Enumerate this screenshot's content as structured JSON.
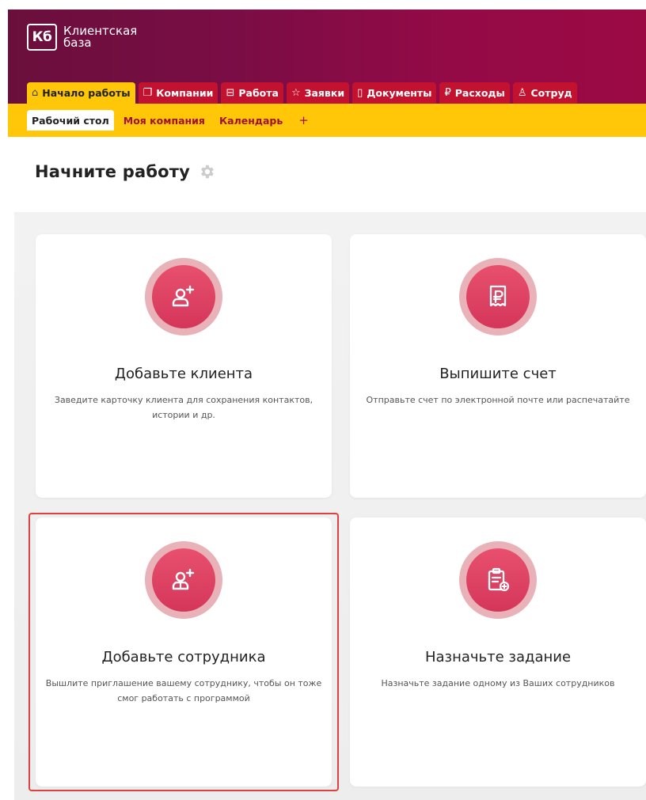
{
  "app": {
    "logo_mark": "Кб",
    "name_line1": "Клиентская",
    "name_line2": "база"
  },
  "tabs": [
    {
      "label": "Начало работы",
      "icon": "home-icon",
      "glyph": "⌂",
      "active": true
    },
    {
      "label": "Компании",
      "icon": "copy-icon",
      "glyph": "❐",
      "active": false
    },
    {
      "label": "Работа",
      "icon": "briefcase-icon",
      "glyph": "⊟",
      "active": false
    },
    {
      "label": "Заявки",
      "icon": "star-icon",
      "glyph": "☆",
      "active": false
    },
    {
      "label": "Документы",
      "icon": "document-icon",
      "glyph": "▯",
      "active": false
    },
    {
      "label": "Расходы",
      "icon": "ruble-icon",
      "glyph": "₽",
      "active": false
    },
    {
      "label": "Сотруд",
      "icon": "users-icon",
      "glyph": "♙",
      "active": false
    }
  ],
  "subtabs": [
    {
      "label": "Рабочий стол",
      "active": true
    },
    {
      "label": "Моя компания",
      "active": false
    },
    {
      "label": "Календарь",
      "active": false
    }
  ],
  "subnav_plus": "+",
  "page_title": "Начните работу",
  "cards": [
    {
      "title": "Добавьте клиента",
      "description": "Заведите карточку клиента для сохранения контактов, истории и др.",
      "icon": "add-user-icon"
    },
    {
      "title": "Выпишите счет",
      "description": "Отправьте счет по электронной почте или распечатайте",
      "icon": "receipt-ruble-icon"
    },
    {
      "title": "Добавьте сотрудника",
      "description": "Вышлите приглашение вашему сотруднику, чтобы он тоже смог работать с программой",
      "icon": "add-employee-icon",
      "highlighted": true
    },
    {
      "title": "Назначьте задание",
      "description": "Назначьте задание одному из Ваших сотрудников",
      "icon": "clipboard-add-icon"
    }
  ],
  "colors": {
    "header_start": "#6a0f3c",
    "header_end": "#9c0a44",
    "tab": "#c3122f",
    "active_tab": "#ffc708",
    "accent_pink": "#e8506e",
    "highlight_border": "#e04040"
  }
}
